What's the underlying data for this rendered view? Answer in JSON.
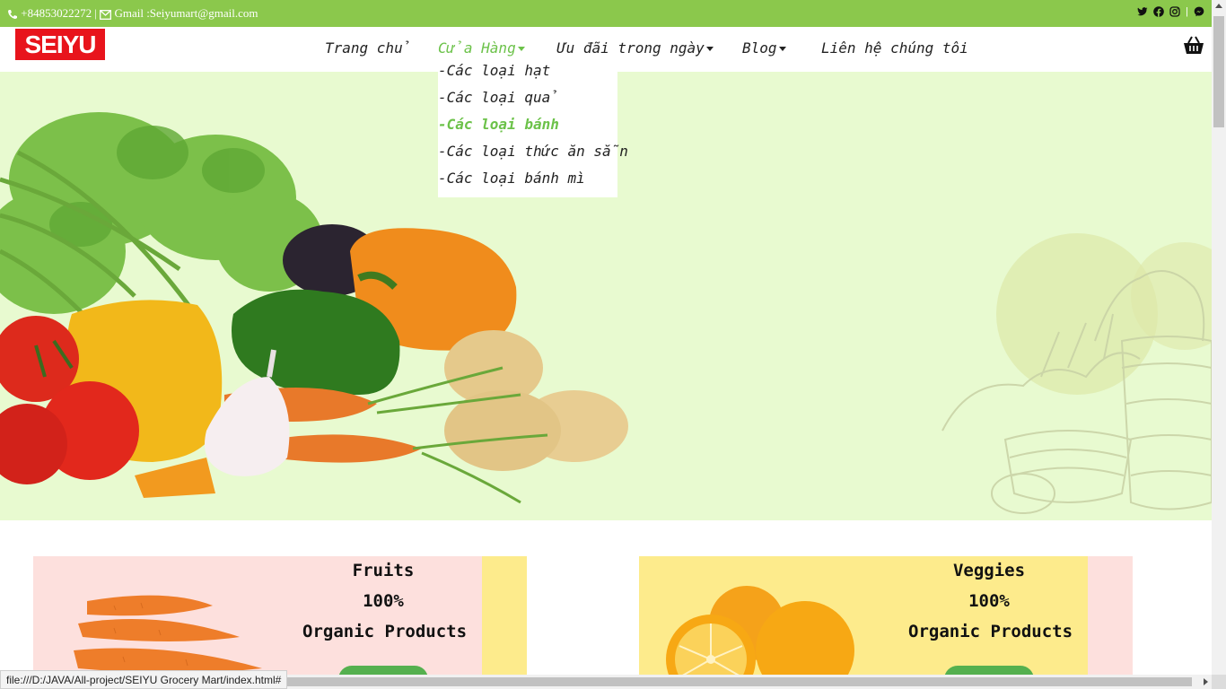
{
  "topbar": {
    "phone": "+84853022272",
    "separator": "|",
    "email": "Gmail :Seiyumart@gmail.com",
    "social": [
      "twitter-icon",
      "facebook-icon",
      "instagram-icon",
      "messenger-icon"
    ],
    "social_separator": "|"
  },
  "header": {
    "logo_text": "SEIYU",
    "nav": [
      {
        "label": "Trang chủ"
      },
      {
        "label": "Cửa Hàng"
      },
      {
        "label": "Ưu đãi trong ngày"
      },
      {
        "label": "Blog"
      },
      {
        "label": "Liên hệ chúng tôi"
      }
    ],
    "cart_icon": "basket-icon"
  },
  "dropdown": {
    "items": [
      {
        "label": "-Các loại hạt"
      },
      {
        "label": "-Các loại quả"
      },
      {
        "label": "-Các loại bánh"
      },
      {
        "label": "-Các loại thức ăn sẵn"
      },
      {
        "label": "-Các loại bánh mì"
      }
    ],
    "hovered_index": 2
  },
  "cards": [
    {
      "line1": "Fruits",
      "line2": "100%",
      "line3": "Organic Products",
      "image": "carrots"
    },
    {
      "line1": "Veggies",
      "line2": "100%",
      "line3": "Organic Products",
      "image": "oranges"
    }
  ],
  "status_bar": {
    "url": "file:///D:/JAVA/All-project/SEIYU Grocery Mart/index.html#"
  },
  "colors": {
    "topbar_bg": "#8bc84c",
    "accent_green": "#6cc24a",
    "hero_bg": "#e8fad0",
    "logo_red": "#e8141c",
    "card_pink": "#fde0dd",
    "card_yellow": "#fdeb8c"
  }
}
